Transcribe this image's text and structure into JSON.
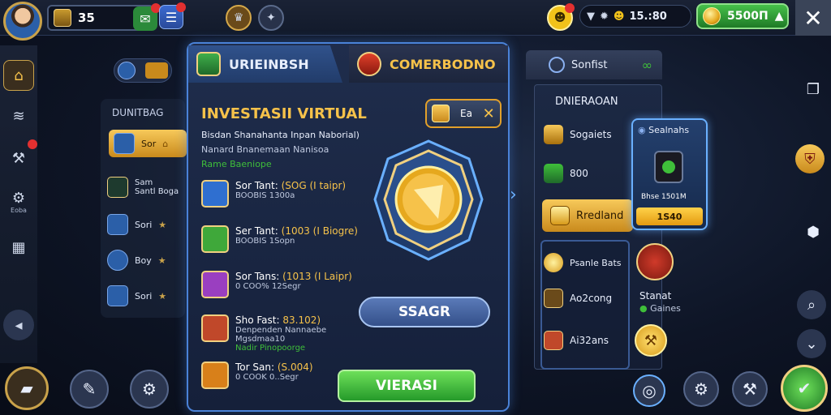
{
  "topbar": {
    "resource_value": "35",
    "stat_value": "15.:80",
    "gold_value": "5500П",
    "icons": [
      "avatar",
      "trophy-icon",
      "gift-icon",
      "notes-icon",
      "compass-icon",
      "emblem-icon",
      "emoji-icon",
      "signal-icon",
      "settings-icon",
      "close-icon"
    ]
  },
  "left_rail": {
    "items": [
      {
        "icon": "home-icon"
      },
      {
        "icon": "layers-icon"
      },
      {
        "icon": "wrench-icon"
      },
      {
        "icon": "gear-icon",
        "label": "Eoba"
      },
      {
        "icon": "document-icon"
      },
      {
        "icon": "back-icon"
      }
    ]
  },
  "list_panel": {
    "title": "DUNITBAG",
    "items": [
      {
        "label": "Sor"
      },
      {
        "label": "Sam\nSantl Boga"
      },
      {
        "label": "Sori"
      },
      {
        "label": "Boy"
      },
      {
        "label": "Sori"
      }
    ]
  },
  "main_panel": {
    "tab_left": "URIEINBSH",
    "tab_right": "COMERBODNO",
    "section_title": "INVESTASII VIRTUAL",
    "sub1": "Bisdan Shanahanta Inpan Naborial)",
    "sub2": "Nanard Bnanemaan Nanisoa",
    "sub3": "Rame Baeniope",
    "toggle_label": "Ea",
    "rewards": [
      {
        "name": "Sor Tant:",
        "highlight": "(SOG (I taipr)",
        "sub": "BOOBIS 1300a",
        "color": "#2f6fd0"
      },
      {
        "name": "Ser Tant:",
        "highlight": "(1003 (I Biogre)",
        "sub": "BOOBIS 1Sopn",
        "color": "#3fa83a"
      },
      {
        "name": "Sor Tans:",
        "highlight": "(1013 (I Laipr)",
        "sub": "0 COO% 12Segr",
        "color": "#9a3fc0"
      },
      {
        "name": "Sho Fast:",
        "highlight": "83.102)",
        "sub": "Denpenden Nannaebe Mgsdmaa10",
        "sub2": "Nadir Pinopoorge",
        "color": "#c0482a"
      },
      {
        "name": "Tor San:",
        "highlight": "(S.004)",
        "sub": "0 COOK 0..Segr",
        "color": "#d8801a"
      }
    ],
    "search_button": "SSAGR",
    "primary_button": "VIERASI"
  },
  "right_panel": {
    "header": "Sonfist",
    "title": "DNIERAOAN",
    "items": [
      {
        "label": "Sogaiets"
      },
      {
        "label": "800"
      },
      {
        "label": "Rredland"
      }
    ],
    "list_items": [
      {
        "label": "Psanle Bats"
      },
      {
        "label": "Ao2cong"
      },
      {
        "label": "Ai32ans"
      }
    ],
    "feature": {
      "title": "Sealnahs",
      "subtitle": "Bhse 1501M",
      "button": "1S40"
    },
    "side_label_1": "Stanat",
    "side_label_2": "Gaines"
  },
  "colors": {
    "accent_gold": "#f6c24a",
    "accent_blue": "#4a82d8",
    "accent_green": "#3fbf3a"
  }
}
